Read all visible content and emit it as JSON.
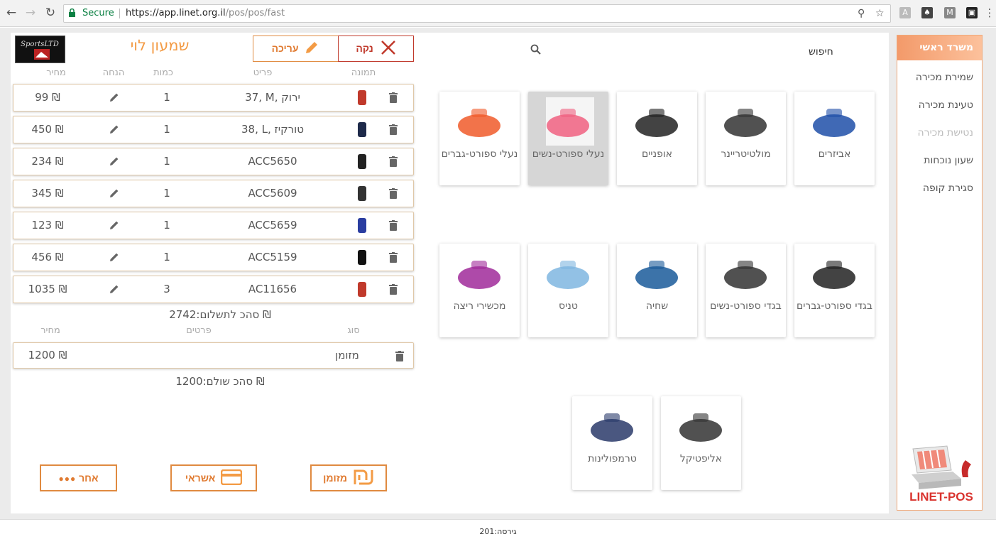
{
  "browser": {
    "secure_label": "Secure",
    "url_host": "https://app.linet.org.il",
    "url_path": "/pos/pos/fast"
  },
  "header": {
    "customer_name": "שמעון לוי",
    "store_logo_text": "SportsLTD",
    "edit_label": "עריכה",
    "clear_label": "נקה"
  },
  "cart": {
    "columns": {
      "image": "תמונה",
      "item": "פריט",
      "qty": "כמות",
      "discount": "הנחה",
      "price": "מחיר"
    },
    "lines": [
      {
        "desc": "37, M, ירוק",
        "qty": "1",
        "price": "99 ₪",
        "thumb_color": "#c0392b"
      },
      {
        "desc": "38, L, טורקיז",
        "qty": "1",
        "price": "450 ₪",
        "thumb_color": "#1e2a4a"
      },
      {
        "desc": "ACC5650",
        "qty": "1",
        "price": "234 ₪",
        "thumb_color": "#222"
      },
      {
        "desc": "ACC5609",
        "qty": "1",
        "price": "345 ₪",
        "thumb_color": "#333"
      },
      {
        "desc": "ACC5659",
        "qty": "1",
        "price": "123 ₪",
        "thumb_color": "#2a3da0"
      },
      {
        "desc": "ACC5159",
        "qty": "1",
        "price": "456 ₪",
        "thumb_color": "#111"
      },
      {
        "desc": "AC11656",
        "qty": "3",
        "price": "1035 ₪",
        "thumb_color": "#c0392b"
      }
    ],
    "total_label": "סהכ לתשלום:2742 ₪"
  },
  "payments": {
    "columns": {
      "type": "סוג",
      "details": "פרטים",
      "price": "מחיר"
    },
    "rows": [
      {
        "type": "מזומן",
        "amount": "1200 ₪"
      }
    ],
    "total_paid_label": "סהכ שולם:1200 ₪"
  },
  "pay_buttons": {
    "cash": "מזומן",
    "credit": "אשראי",
    "other": "אחר"
  },
  "search": {
    "label": "חיפוש"
  },
  "categories": [
    {
      "label": "אביזרים",
      "color": "#1f4fa8",
      "selected": false
    },
    {
      "label": "מולטיטריינר",
      "color": "#333",
      "selected": false
    },
    {
      "label": "אופניים",
      "color": "#222",
      "selected": false
    },
    {
      "label": "נעלי ספורט-נשים",
      "color": "#f06080",
      "selected": true
    },
    {
      "label": "נעלי ספורט-גברים",
      "color": "#f05a2a",
      "selected": false
    },
    {
      "label": "בגדי ספורט-גברים",
      "color": "#222",
      "selected": false
    },
    {
      "label": "בגדי ספורט-נשים",
      "color": "#333",
      "selected": false
    },
    {
      "label": "שחיה",
      "color": "#1a5a9a",
      "selected": false
    },
    {
      "label": "טניס",
      "color": "#7fb6e0",
      "selected": false
    },
    {
      "label": "מכשירי ריצה",
      "color": "#a02a9a",
      "selected": false
    },
    {
      "label": "אליפטיקל",
      "color": "#333",
      "selected": false
    },
    {
      "label": "טרמפולינות",
      "color": "#2a3a6a",
      "selected": false
    }
  ],
  "sidebar": {
    "header": "משרד ראשי",
    "items": [
      {
        "label": "שמירת מכירה",
        "disabled": false
      },
      {
        "label": "טעינת מכירה",
        "disabled": false
      },
      {
        "label": "נטישת מכירה",
        "disabled": true
      },
      {
        "label": "שעון נוכחות",
        "disabled": false
      },
      {
        "label": "סגירת קופה",
        "disabled": false
      }
    ],
    "logo_text": "LINET-POS"
  },
  "footer": {
    "version": "גירסה:201"
  },
  "colors": {
    "accent": "#f39b45",
    "danger": "#c0392b",
    "secure": "#0b8043"
  }
}
